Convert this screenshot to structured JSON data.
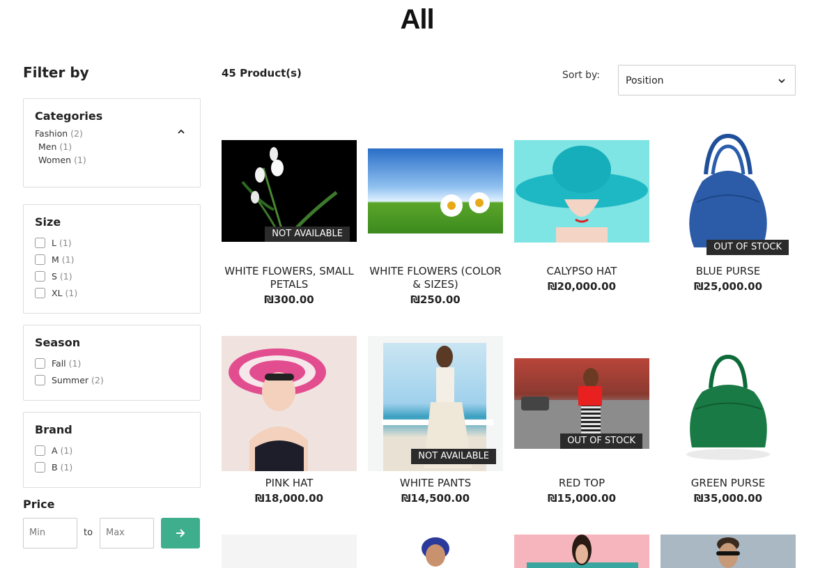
{
  "page": {
    "title": "All"
  },
  "filters": {
    "heading": "Filter by",
    "categories": {
      "title": "Categories",
      "items": [
        {
          "label": "Fashion",
          "count": "(2)"
        },
        {
          "label": "Men",
          "count": "(1)"
        },
        {
          "label": "Women",
          "count": "(1)"
        }
      ]
    },
    "size": {
      "title": "Size",
      "options": [
        {
          "label": "L",
          "count": "(1)"
        },
        {
          "label": "M",
          "count": "(1)"
        },
        {
          "label": "S",
          "count": "(1)"
        },
        {
          "label": "XL",
          "count": "(1)"
        }
      ]
    },
    "season": {
      "title": "Season",
      "options": [
        {
          "label": "Fall",
          "count": "(1)"
        },
        {
          "label": "Summer",
          "count": "(2)"
        }
      ]
    },
    "brand": {
      "title": "Brand",
      "options": [
        {
          "label": "A",
          "count": "(1)"
        },
        {
          "label": "B",
          "count": "(1)"
        }
      ]
    },
    "price": {
      "label": "Price",
      "min_placeholder": "Min",
      "max_placeholder": "Max",
      "separator": "to"
    }
  },
  "toolbar": {
    "product_count": "45 Product(s)",
    "sort_label": "Sort by:",
    "sort_value": "Position"
  },
  "products": [
    {
      "name": "WHITE FLOWERS, SMALL PETALS",
      "price": "₪300.00",
      "badge": "NOT AVAILABLE"
    },
    {
      "name": "WHITE FLOWERS (COLOR & SIZES)",
      "price": "₪250.00",
      "badge": ""
    },
    {
      "name": "CALYPSO HAT",
      "price": "₪20,000.00",
      "badge": ""
    },
    {
      "name": "BLUE PURSE",
      "price": "₪25,000.00",
      "badge": "OUT OF STOCK"
    },
    {
      "name": "PINK HAT",
      "price": "₪18,000.00",
      "badge": ""
    },
    {
      "name": "WHITE PANTS",
      "price": "₪14,500.00",
      "badge": "NOT AVAILABLE"
    },
    {
      "name": "RED TOP",
      "price": "₪15,000.00",
      "badge": "OUT OF STOCK"
    },
    {
      "name": "GREEN PURSE",
      "price": "₪35,000.00",
      "badge": ""
    }
  ],
  "colors": {
    "accent": "#3fae8c",
    "badge_bg": "#2b2b2b"
  }
}
